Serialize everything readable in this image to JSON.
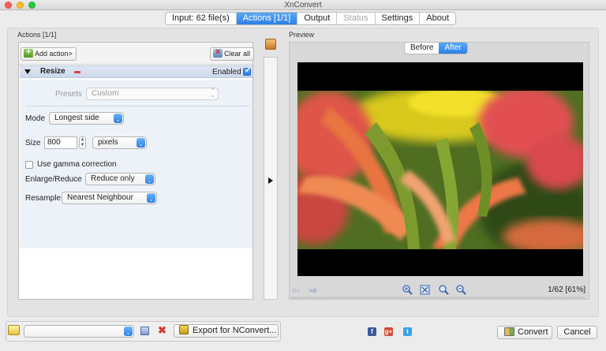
{
  "window": {
    "title": "XnConvert"
  },
  "tabs": [
    {
      "label": "Input: 62 file(s)",
      "state": "normal"
    },
    {
      "label": "Actions [1/1]",
      "state": "active"
    },
    {
      "label": "Output",
      "state": "normal"
    },
    {
      "label": "Status",
      "state": "disabled"
    },
    {
      "label": "Settings",
      "state": "normal"
    },
    {
      "label": "About",
      "state": "normal"
    }
  ],
  "actions_panel": {
    "title": "Actions [1/1]",
    "add_action_label": "Add action>",
    "clear_all_label": "Clear all",
    "action": {
      "name": "Resize",
      "enabled_label": "Enabled",
      "enabled": true,
      "presets_label": "Presets",
      "presets_value": "Custom",
      "mode_label": "Mode",
      "mode_value": "Longest side",
      "size_label": "Size",
      "size_value": "800",
      "unit_value": "pixels",
      "gamma_label": "Use gamma correction",
      "gamma_checked": false,
      "enlarge_label": "Enlarge/Reduce",
      "enlarge_value": "Reduce only",
      "resample_label": "Resample",
      "resample_value": "Nearest Neighbour"
    }
  },
  "preview": {
    "title": "Preview",
    "before_label": "Before",
    "after_label": "After",
    "active_view": "After",
    "counter": "1/62 [61%]"
  },
  "bottom": {
    "path_value": "",
    "export_label": "Export for NConvert...",
    "convert_label": "Convert",
    "cancel_label": "Cancel"
  },
  "colors": {
    "accent": "#2b7fe6",
    "facebook": "#3b5998",
    "googleplus": "#d34836",
    "twitter": "#3aa3e3"
  },
  "icons": {
    "social": [
      "facebook-icon",
      "google-plus-icon",
      "twitter-icon"
    ]
  }
}
